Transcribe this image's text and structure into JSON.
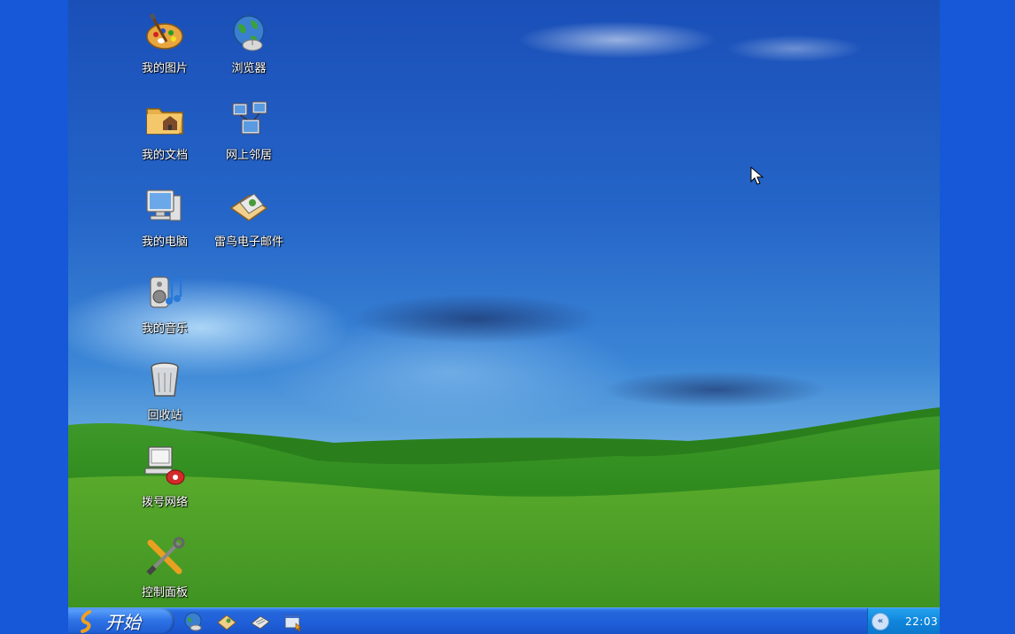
{
  "desktop": {
    "icons": [
      {
        "label": "我的图片",
        "icon": "paint-palette-icon"
      },
      {
        "label": "浏览器",
        "icon": "globe-mouse-icon"
      },
      {
        "label": "我的文档",
        "icon": "folder-house-icon"
      },
      {
        "label": "网上邻居",
        "icon": "network-computers-icon"
      },
      {
        "label": "我的电脑",
        "icon": "computer-monitor-icon"
      },
      {
        "label": "雷鸟电子邮件",
        "icon": "envelope-icon"
      },
      {
        "label": "我的音乐",
        "icon": "speaker-music-icon"
      },
      {
        "label": "回收站",
        "icon": "recycle-bin-icon"
      },
      {
        "label": "拨号网络",
        "icon": "dialup-phone-icon"
      },
      {
        "label": "控制面板",
        "icon": "tools-icon"
      }
    ]
  },
  "taskbar": {
    "start_label": "开始",
    "quick_launch": [
      {
        "icon": "browser-globe-icon"
      },
      {
        "icon": "email-icon"
      },
      {
        "icon": "office-document-icon"
      },
      {
        "icon": "show-desktop-icon"
      }
    ],
    "clock": "22:03"
  },
  "colors": {
    "outer_background": "#1658d8",
    "taskbar_blue": "#1f5ed8",
    "start_button": "#2f74e6",
    "tray": "#0f86dc"
  }
}
